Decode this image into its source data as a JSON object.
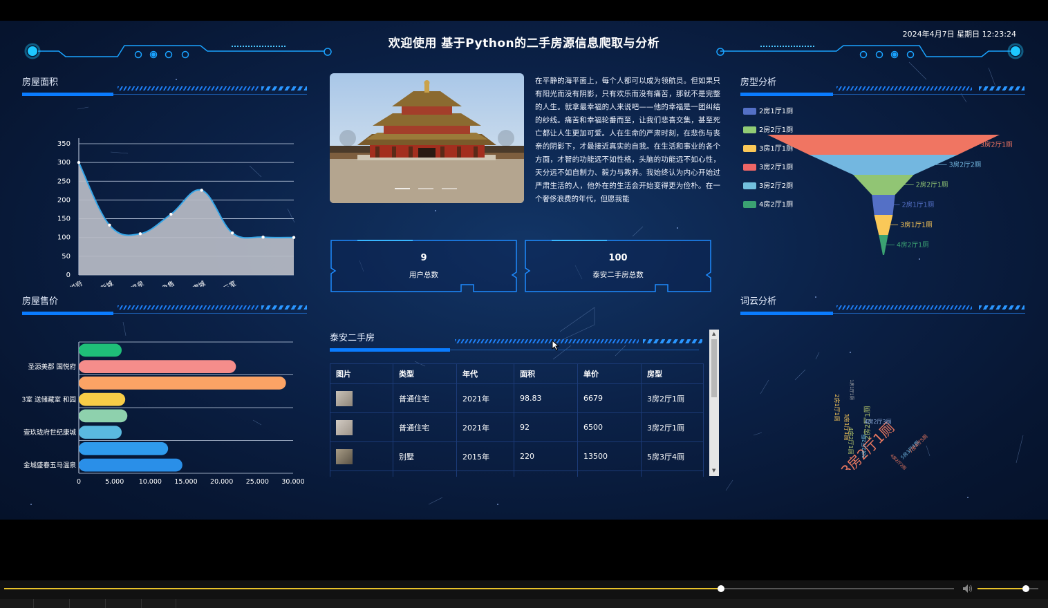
{
  "header": {
    "title": "欢迎使用 基于Python的二手房源信息爬取与分析",
    "datetime": "2024年4月7日 星期日 12:23:24"
  },
  "panels": {
    "area": "房屋面积",
    "price": "房屋售价",
    "layout": "房型分析",
    "wordcloud": "词云分析",
    "listing": "泰安二手房"
  },
  "intro_text": "在平静的海平面上，每个人都可以成为领航员。但如果只有阳光而没有阴影，只有欢乐而没有痛苦，那就不是完整的人生。就拿最幸福的人来说吧——他的幸福是一团纠结的纱线。痛苦和幸福轮番而至，让我们悲喜交集，甚至死亡都让人生更加可爱。人在生命的严肃时刻，在悲伤与丧亲的阴影下，才最接近真实的自我。在生活和事业的各个方面，才智的功能远不如性格，头脑的功能远不如心性，天分远不如自制力、毅力与教养。我始终认为内心开始过严肃生活的人，他外在的生活会开始变得更为俭朴。在一个奢侈浪费的年代，但愿我能",
  "stats": [
    {
      "value": "9",
      "label": "用户总数"
    },
    {
      "value": "100",
      "label": "泰安二手房总数"
    }
  ],
  "table": {
    "headers": [
      "图片",
      "类型",
      "年代",
      "面积",
      "单价",
      "房型"
    ],
    "rows": [
      {
        "type": "普通住宅",
        "year": "2021年",
        "area": "98.83",
        "price": "6679",
        "layout": "3房2厅1厕"
      },
      {
        "type": "普通住宅",
        "year": "2021年",
        "area": "92",
        "price": "6500",
        "layout": "3房2厅1厕"
      },
      {
        "type": "别墅",
        "year": "2015年",
        "area": "220",
        "price": "13500",
        "layout": "5房3厅4厕"
      }
    ]
  },
  "colors": {
    "accent": "#0a7cff",
    "panel_bg": "#0b2147",
    "area_fill": "#b8bcc6",
    "area_line": "#35a6e8"
  },
  "chart_data": [
    {
      "type": "area",
      "title": "房屋面积",
      "categories": [
        "圣源美郡 国悦府",
        "世家一中 嘉和新城",
        "金城盛春五马温泉",
        "室 房主急售",
        "壹玖珑府世纪康城",
        "泊枫景苑 可改三室",
        ""
      ],
      "values": [
        300,
        133,
        110,
        162,
        226,
        112,
        101,
        100
      ],
      "ylim": [
        0,
        350
      ],
      "yticks": [
        "0",
        "50",
        "100",
        "150",
        "200",
        "250",
        "300",
        "350"
      ],
      "grid": true
    },
    {
      "type": "bar",
      "orientation": "horizontal",
      "title": "房屋售价",
      "categories": [
        "",
        "圣源美郡 国悦府",
        "",
        "3室 送储藏室 和园",
        "",
        "壹玖珑府世纪康城",
        "",
        "金城盛春五马温泉"
      ],
      "values": [
        6000,
        22000,
        29000,
        6500,
        6800,
        6000,
        12500,
        14500
      ],
      "bar_colors": [
        "#1fbf78",
        "#f58d8b",
        "#fba365",
        "#f7cc47",
        "#8ed1ad",
        "#5ab9e0",
        "#2f9bed",
        "#2a8fe8"
      ],
      "xlim": [
        0,
        30000
      ],
      "xticks": [
        "0",
        "5,000",
        "10,000",
        "15,000",
        "20,000",
        "25,000",
        "30,000"
      ]
    },
    {
      "type": "funnel",
      "title": "房型分析",
      "legend": [
        {
          "name": "2房1厅1厕",
          "color": "#5470c6"
        },
        {
          "name": "2房2厅1厕",
          "color": "#91cc75"
        },
        {
          "name": "3房1厅1厕",
          "color": "#fac858"
        },
        {
          "name": "3房2厅1厕",
          "color": "#ee6666"
        },
        {
          "name": "3房2厅2厕",
          "color": "#73c0de"
        },
        {
          "name": "4房2厅1厕",
          "color": "#3ba272"
        }
      ],
      "slices": [
        {
          "name": "3房2厅1厕",
          "value": 100,
          "color": "#f07562"
        },
        {
          "name": "3房2厅2厕",
          "value": 64,
          "color": "#73b7e0"
        },
        {
          "name": "2房2厅1厕",
          "value": 26,
          "color": "#91c574"
        },
        {
          "name": "2房1厅1厕",
          "value": 10,
          "color": "#5470c6"
        },
        {
          "name": "3房1厅1厕",
          "value": 8,
          "color": "#fac858"
        },
        {
          "name": "4房2厅1厕",
          "value": 4,
          "color": "#3ba272"
        }
      ],
      "legend_position": "left"
    },
    {
      "type": "wordcloud",
      "title": "词云分析",
      "words": [
        {
          "text": "3房2厅1厕",
          "color": "#e8775f"
        },
        {
          "text": "2房2厅1厕",
          "color": "#b6c86b"
        },
        {
          "text": "4房2厅1厕",
          "color": "#b6c86b"
        },
        {
          "text": "2房1厅1厕",
          "color": "#fac858"
        },
        {
          "text": "3房1厅1厕",
          "color": "#fac858"
        },
        {
          "text": "4房2厅3厕",
          "color": "#8ba9d8"
        },
        {
          "text": "5房3厅4厕",
          "color": "#73b7e0"
        },
        {
          "text": "4房2厅2厕",
          "color": "#e8775f"
        },
        {
          "text": "7房4厅5厕",
          "color": "#e8775f"
        },
        {
          "text": "3房2厅2厕",
          "color": "#73c0de"
        },
        {
          "text": "1房1厅1厕",
          "color": "#b0b0b0"
        }
      ]
    }
  ],
  "player": {
    "progress": 0.755,
    "volume": 0.8
  }
}
